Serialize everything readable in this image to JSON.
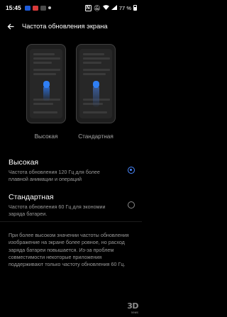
{
  "status_bar": {
    "time": "15:45",
    "battery_percent": "77 %",
    "left_icon_colors": [
      "#1e5bd8",
      "#d83a3a",
      "#4a4a4a",
      "#c9c9c9"
    ],
    "right_icons": [
      "nfc-icon",
      "mute-icon",
      "wifi-icon",
      "signal-icon",
      "battery-icon"
    ]
  },
  "header": {
    "back_icon": "arrow-left-icon",
    "title": "Частота обновления экрана"
  },
  "previews": {
    "high_label": "Высокая",
    "standard_label": "Стандартная"
  },
  "options": [
    {
      "title": "Высокая",
      "description": "Частота обновления 120 Гц для более плавной анимации и операций",
      "selected": true
    },
    {
      "title": "Стандартная",
      "description": "Частота обновления 60 Гц для экономии заряда батареи.",
      "selected": false
    }
  ],
  "note": "При более высоком значении частоты обновления изображение на экране более ровное, но расход заряда батареи повышается. Из-за проблем совместимости некоторые приложения поддерживают только частоту обновления 60 Гц.",
  "watermark": {
    "main": "3D",
    "sub": "news"
  },
  "colors": {
    "accent": "#4a88ff",
    "background": "#000000",
    "secondary_text": "#9a9a9a"
  }
}
